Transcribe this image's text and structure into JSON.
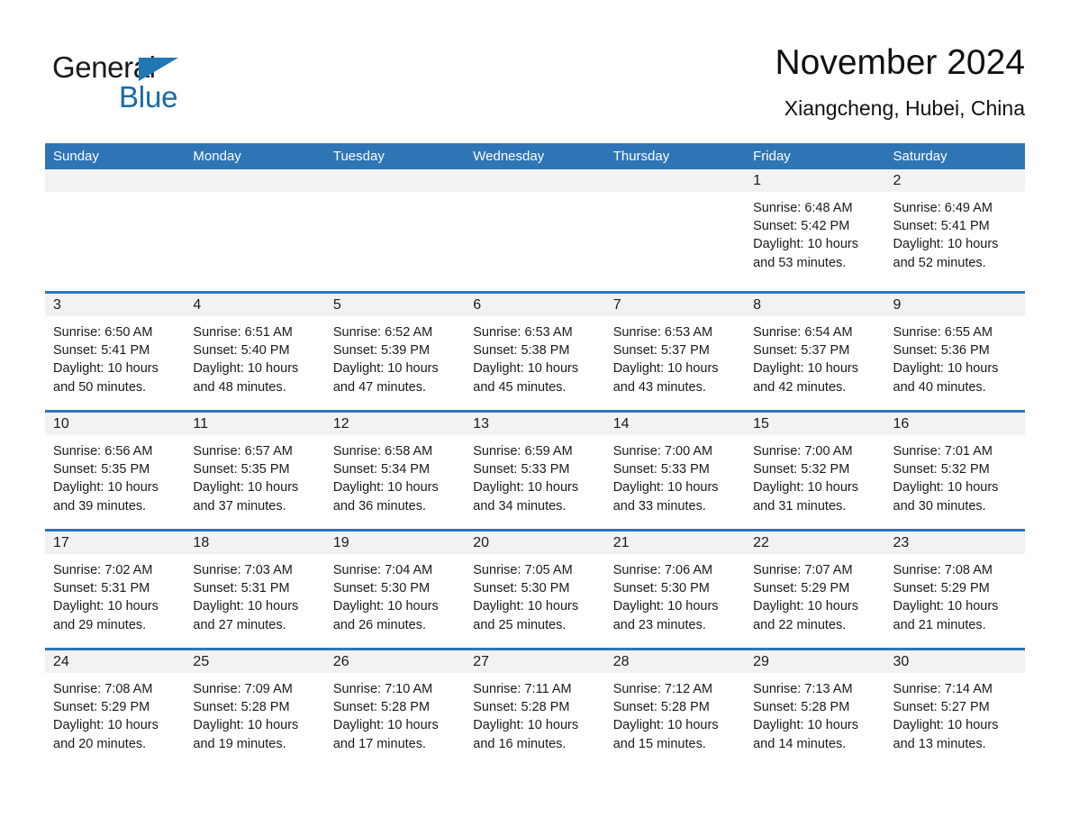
{
  "logo": {
    "word_one": "General",
    "word_two": "Blue",
    "triangle_color": "#1f77b4",
    "blue_color": "#1769aa"
  },
  "header": {
    "month_title": "November 2024",
    "location": "Xiangcheng, Hubei, China"
  },
  "theme": {
    "header_band": "#2e75b6",
    "day_band": "#f2f2f2",
    "text": "#1a1a1a"
  },
  "calendar": {
    "day_names": [
      "Sunday",
      "Monday",
      "Tuesday",
      "Wednesday",
      "Thursday",
      "Friday",
      "Saturday"
    ],
    "weeks": [
      [
        {
          "day": "",
          "empty": true
        },
        {
          "day": "",
          "empty": true
        },
        {
          "day": "",
          "empty": true
        },
        {
          "day": "",
          "empty": true
        },
        {
          "day": "",
          "empty": true
        },
        {
          "day": "1",
          "sunrise": "Sunrise: 6:48 AM",
          "sunset": "Sunset: 5:42 PM",
          "daylight_1": "Daylight: 10 hours",
          "daylight_2": "and 53 minutes."
        },
        {
          "day": "2",
          "sunrise": "Sunrise: 6:49 AM",
          "sunset": "Sunset: 5:41 PM",
          "daylight_1": "Daylight: 10 hours",
          "daylight_2": "and 52 minutes."
        }
      ],
      [
        {
          "day": "3",
          "sunrise": "Sunrise: 6:50 AM",
          "sunset": "Sunset: 5:41 PM",
          "daylight_1": "Daylight: 10 hours",
          "daylight_2": "and 50 minutes."
        },
        {
          "day": "4",
          "sunrise": "Sunrise: 6:51 AM",
          "sunset": "Sunset: 5:40 PM",
          "daylight_1": "Daylight: 10 hours",
          "daylight_2": "and 48 minutes."
        },
        {
          "day": "5",
          "sunrise": "Sunrise: 6:52 AM",
          "sunset": "Sunset: 5:39 PM",
          "daylight_1": "Daylight: 10 hours",
          "daylight_2": "and 47 minutes."
        },
        {
          "day": "6",
          "sunrise": "Sunrise: 6:53 AM",
          "sunset": "Sunset: 5:38 PM",
          "daylight_1": "Daylight: 10 hours",
          "daylight_2": "and 45 minutes."
        },
        {
          "day": "7",
          "sunrise": "Sunrise: 6:53 AM",
          "sunset": "Sunset: 5:37 PM",
          "daylight_1": "Daylight: 10 hours",
          "daylight_2": "and 43 minutes."
        },
        {
          "day": "8",
          "sunrise": "Sunrise: 6:54 AM",
          "sunset": "Sunset: 5:37 PM",
          "daylight_1": "Daylight: 10 hours",
          "daylight_2": "and 42 minutes."
        },
        {
          "day": "9",
          "sunrise": "Sunrise: 6:55 AM",
          "sunset": "Sunset: 5:36 PM",
          "daylight_1": "Daylight: 10 hours",
          "daylight_2": "and 40 minutes."
        }
      ],
      [
        {
          "day": "10",
          "sunrise": "Sunrise: 6:56 AM",
          "sunset": "Sunset: 5:35 PM",
          "daylight_1": "Daylight: 10 hours",
          "daylight_2": "and 39 minutes."
        },
        {
          "day": "11",
          "sunrise": "Sunrise: 6:57 AM",
          "sunset": "Sunset: 5:35 PM",
          "daylight_1": "Daylight: 10 hours",
          "daylight_2": "and 37 minutes."
        },
        {
          "day": "12",
          "sunrise": "Sunrise: 6:58 AM",
          "sunset": "Sunset: 5:34 PM",
          "daylight_1": "Daylight: 10 hours",
          "daylight_2": "and 36 minutes."
        },
        {
          "day": "13",
          "sunrise": "Sunrise: 6:59 AM",
          "sunset": "Sunset: 5:33 PM",
          "daylight_1": "Daylight: 10 hours",
          "daylight_2": "and 34 minutes."
        },
        {
          "day": "14",
          "sunrise": "Sunrise: 7:00 AM",
          "sunset": "Sunset: 5:33 PM",
          "daylight_1": "Daylight: 10 hours",
          "daylight_2": "and 33 minutes."
        },
        {
          "day": "15",
          "sunrise": "Sunrise: 7:00 AM",
          "sunset": "Sunset: 5:32 PM",
          "daylight_1": "Daylight: 10 hours",
          "daylight_2": "and 31 minutes."
        },
        {
          "day": "16",
          "sunrise": "Sunrise: 7:01 AM",
          "sunset": "Sunset: 5:32 PM",
          "daylight_1": "Daylight: 10 hours",
          "daylight_2": "and 30 minutes."
        }
      ],
      [
        {
          "day": "17",
          "sunrise": "Sunrise: 7:02 AM",
          "sunset": "Sunset: 5:31 PM",
          "daylight_1": "Daylight: 10 hours",
          "daylight_2": "and 29 minutes."
        },
        {
          "day": "18",
          "sunrise": "Sunrise: 7:03 AM",
          "sunset": "Sunset: 5:31 PM",
          "daylight_1": "Daylight: 10 hours",
          "daylight_2": "and 27 minutes."
        },
        {
          "day": "19",
          "sunrise": "Sunrise: 7:04 AM",
          "sunset": "Sunset: 5:30 PM",
          "daylight_1": "Daylight: 10 hours",
          "daylight_2": "and 26 minutes."
        },
        {
          "day": "20",
          "sunrise": "Sunrise: 7:05 AM",
          "sunset": "Sunset: 5:30 PM",
          "daylight_1": "Daylight: 10 hours",
          "daylight_2": "and 25 minutes."
        },
        {
          "day": "21",
          "sunrise": "Sunrise: 7:06 AM",
          "sunset": "Sunset: 5:30 PM",
          "daylight_1": "Daylight: 10 hours",
          "daylight_2": "and 23 minutes."
        },
        {
          "day": "22",
          "sunrise": "Sunrise: 7:07 AM",
          "sunset": "Sunset: 5:29 PM",
          "daylight_1": "Daylight: 10 hours",
          "daylight_2": "and 22 minutes."
        },
        {
          "day": "23",
          "sunrise": "Sunrise: 7:08 AM",
          "sunset": "Sunset: 5:29 PM",
          "daylight_1": "Daylight: 10 hours",
          "daylight_2": "and 21 minutes."
        }
      ],
      [
        {
          "day": "24",
          "sunrise": "Sunrise: 7:08 AM",
          "sunset": "Sunset: 5:29 PM",
          "daylight_1": "Daylight: 10 hours",
          "daylight_2": "and 20 minutes."
        },
        {
          "day": "25",
          "sunrise": "Sunrise: 7:09 AM",
          "sunset": "Sunset: 5:28 PM",
          "daylight_1": "Daylight: 10 hours",
          "daylight_2": "and 19 minutes."
        },
        {
          "day": "26",
          "sunrise": "Sunrise: 7:10 AM",
          "sunset": "Sunset: 5:28 PM",
          "daylight_1": "Daylight: 10 hours",
          "daylight_2": "and 17 minutes."
        },
        {
          "day": "27",
          "sunrise": "Sunrise: 7:11 AM",
          "sunset": "Sunset: 5:28 PM",
          "daylight_1": "Daylight: 10 hours",
          "daylight_2": "and 16 minutes."
        },
        {
          "day": "28",
          "sunrise": "Sunrise: 7:12 AM",
          "sunset": "Sunset: 5:28 PM",
          "daylight_1": "Daylight: 10 hours",
          "daylight_2": "and 15 minutes."
        },
        {
          "day": "29",
          "sunrise": "Sunrise: 7:13 AM",
          "sunset": "Sunset: 5:28 PM",
          "daylight_1": "Daylight: 10 hours",
          "daylight_2": "and 14 minutes."
        },
        {
          "day": "30",
          "sunrise": "Sunrise: 7:14 AM",
          "sunset": "Sunset: 5:27 PM",
          "daylight_1": "Daylight: 10 hours",
          "daylight_2": "and 13 minutes."
        }
      ]
    ]
  }
}
